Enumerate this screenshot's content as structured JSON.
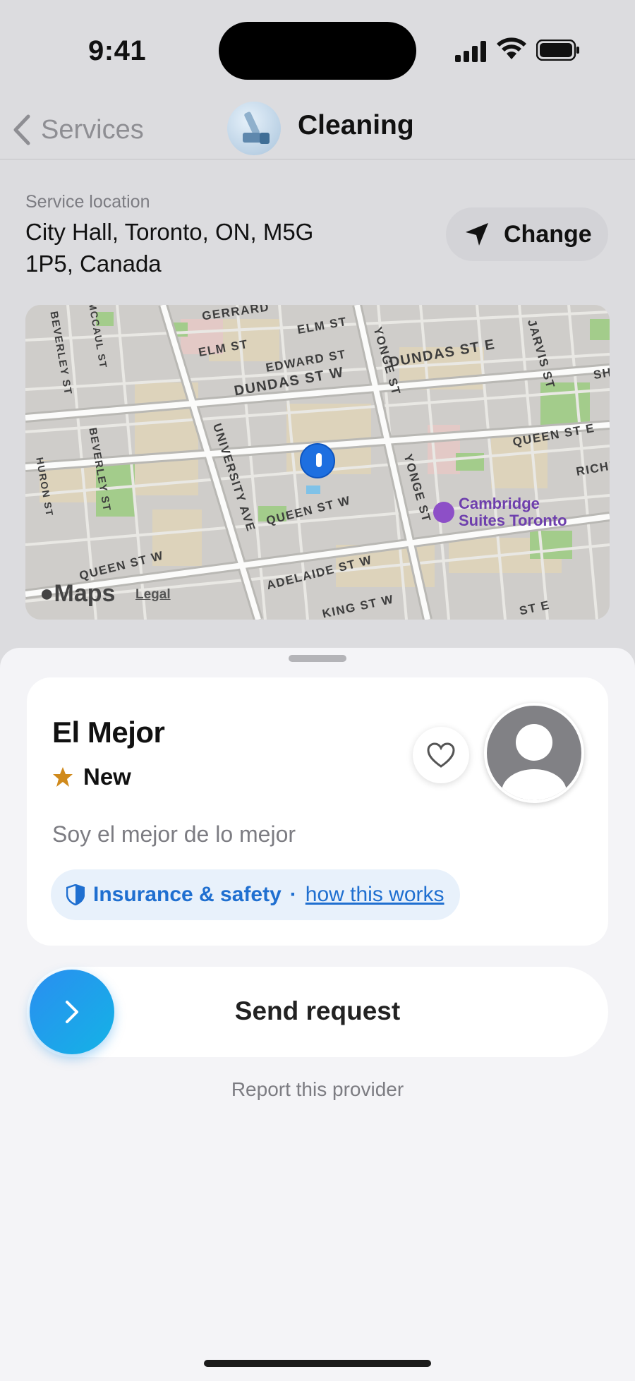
{
  "status_bar": {
    "time": "9:41"
  },
  "nav": {
    "back_label": "Services",
    "title": "Cleaning",
    "service_icon": "cleaning-icon"
  },
  "location": {
    "label": "Service location",
    "address": "City Hall, Toronto, ON, M5G 1P5, Canada",
    "change_label": "Change"
  },
  "map": {
    "roads": [
      "GERRARD",
      "ELM ST",
      "ELM ST",
      "EDWARD ST",
      "DUNDAS ST W",
      "DUNDAS ST E",
      "YONGE ST",
      "YONGE ST",
      "JARVIS ST",
      "BEVERLEY ST",
      "BEVERLEY ST",
      "MCCAUL ST",
      "HURON ST",
      "UNIVERSITY AVE",
      "QUEEN ST W",
      "QUEEN ST W",
      "QUEEN ST E",
      "ADELAIDE ST W",
      "RICHMOND",
      "KING ST W",
      "ST E",
      "SH"
    ],
    "poi_label": "Cambridge Suites Toronto",
    "brand": "Maps",
    "legal": "Legal"
  },
  "provider": {
    "name": "El Mejor",
    "rating_label": "New",
    "description": "Soy el mejor de lo mejor",
    "insurance_label": "Insurance & safety",
    "separator": "·",
    "insurance_link": "how this works"
  },
  "actions": {
    "send_label": "Send request",
    "report_label": "Report this provider"
  },
  "colors": {
    "accent": "#1f6fd0",
    "star": "#d08a1c",
    "send_gradient": [
      "#2a8ef0",
      "#14b3e6"
    ]
  }
}
